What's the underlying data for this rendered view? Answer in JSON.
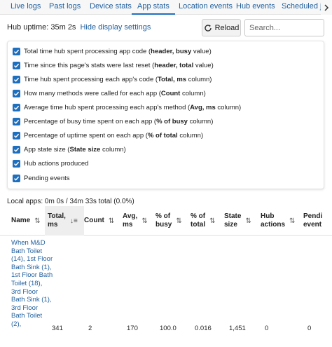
{
  "tabs": [
    {
      "label": "Live logs"
    },
    {
      "label": "Past logs"
    },
    {
      "label": "Device stats"
    },
    {
      "label": "App stats"
    },
    {
      "label": "Location events"
    },
    {
      "label": "Hub events"
    },
    {
      "label": "Scheduled jo"
    }
  ],
  "header": {
    "uptime": "Hub uptime: 35m 2s",
    "display_settings_link": "Hide display settings",
    "reload_label": "Reload",
    "search_placeholder": "Search..."
  },
  "settings": [
    {
      "pre": "Total time hub spent processing app code (",
      "bold": "header, busy",
      "post": " value)"
    },
    {
      "pre": "Time since this page's stats were last reset (",
      "bold": "header, total",
      "post": " value)"
    },
    {
      "pre": "Time hub spent processing each app's code (",
      "bold": "Total, ms",
      "post": " column)"
    },
    {
      "pre": "How many methods were called for each app (",
      "bold": "Count",
      "post": " column)"
    },
    {
      "pre": "Average time hub spent processing each app's method (",
      "bold": "Avg, ms",
      "post": " column)"
    },
    {
      "pre": "Percentage of busy time spent on each app (",
      "bold": "% of busy",
      "post": " column)"
    },
    {
      "pre": "Percentage of uptime spent on each app (",
      "bold": "% of total",
      "post": " column)"
    },
    {
      "pre": "App state size (",
      "bold": "State size",
      "post": " column)"
    },
    {
      "pre": "Hub actions produced",
      "bold": "",
      "post": ""
    },
    {
      "pre": "Pending events",
      "bold": "",
      "post": ""
    }
  ],
  "local_apps_summary": "Local apps: 0m 0s / 34m 33s total (0.0%)",
  "table": {
    "columns": [
      {
        "line1": "Name",
        "line2": "",
        "sort": "⇅"
      },
      {
        "line1": "Total,",
        "line2": "ms",
        "sort": "↓≡"
      },
      {
        "line1": "Count",
        "line2": "",
        "sort": "⇅"
      },
      {
        "line1": "Avg,",
        "line2": "ms",
        "sort": "⇅"
      },
      {
        "line1": "% of",
        "line2": "busy",
        "sort": "⇅"
      },
      {
        "line1": "% of",
        "line2": "total",
        "sort": "⇅"
      },
      {
        "line1": "State",
        "line2": "size",
        "sort": "⇅"
      },
      {
        "line1": "Hub",
        "line2": "actions",
        "sort": "⇅"
      },
      {
        "line1": "Pendi",
        "line2": "event",
        "sort": ""
      }
    ],
    "rows": [
      {
        "name": "When M&D Bath Toilet (14), 1st Floor Bath Sink (1), 1st Floor Bath Toilet (18), 3rd Floor Bath Sink (1), 3rd Floor Bath Toilet (2),",
        "total_ms": "341",
        "count": "2",
        "avg_ms": "170",
        "pct_busy": "100.0",
        "pct_total": "0.016",
        "state_size": "1,451",
        "hub_actions": "0",
        "pending_events": "0"
      }
    ]
  },
  "colors": {
    "accent": "#1f6fbf",
    "link": "#1f5f9e"
  }
}
